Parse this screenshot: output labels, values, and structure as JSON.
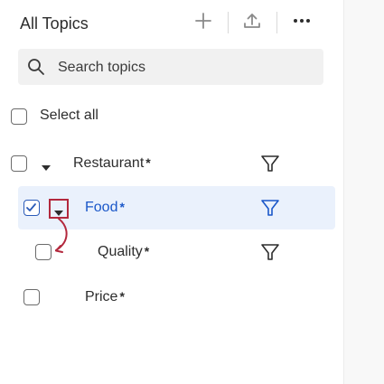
{
  "header": {
    "title": "All Topics",
    "add_icon": "plus-icon",
    "upload_icon": "upload-icon",
    "more_icon": "more-horizontal-icon"
  },
  "search": {
    "placeholder": "Search topics",
    "value": ""
  },
  "select_all": {
    "label": "Select all",
    "checked": false
  },
  "topics": [
    {
      "name": "Restaurant",
      "star": "*",
      "checked": false,
      "expanded": true,
      "selected": false
    },
    {
      "name": "Food",
      "star": "*",
      "checked": true,
      "expanded": true,
      "selected": true
    },
    {
      "name": "Quality",
      "star": "*",
      "checked": false,
      "selected": false
    },
    {
      "name": "Price",
      "star": "*",
      "checked": false,
      "selected": false
    }
  ],
  "colors": {
    "selected_text": "#1a57c9",
    "selected_row_bg": "#eaf1fc",
    "annotation_red": "#b3283d",
    "icon_gray": "#8a8a8a"
  }
}
